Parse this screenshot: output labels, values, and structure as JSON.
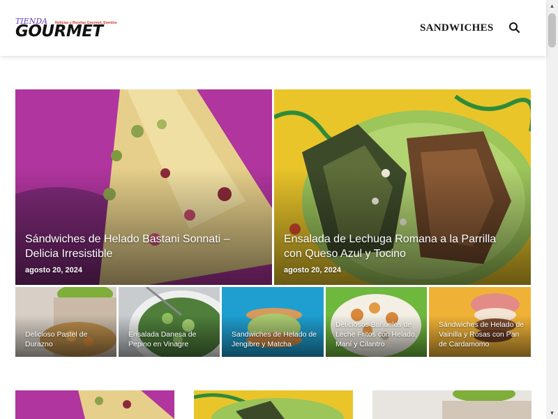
{
  "header": {
    "logo": {
      "top": "TIENDA",
      "main": "GOURMET",
      "tagline": "Noticias y Recetas Gourmet, Eventos"
    },
    "nav": {
      "sandwiches_label": "SANDWICHES"
    },
    "search_icon": "search-icon"
  },
  "featured": [
    {
      "title": "Sándwiches de Helado Bastani Sonnati – Delicia Irresistible",
      "date": "agosto 20, 2024"
    },
    {
      "title": "Ensalada de Lechuga Romana a la Parrilla con Queso Azul y Tocino",
      "date": "agosto 20, 2024"
    }
  ],
  "posts": [
    {
      "title": "Delicioso Pastel de Durazno"
    },
    {
      "title": "Ensalada Danesa de Pepino en Vinagre"
    },
    {
      "title": "Sandwiches de Helado de Jengibre y Matcha"
    },
    {
      "title": "Deliciosos Buñuelos de Leche Fritos con Helado, Maní y Cilantro"
    },
    {
      "title": "Sándwiches de Helado de Vainilla y Rosas con Pan de Cardamomo"
    }
  ],
  "colors": {
    "logo_accent": "#6a3fc2",
    "logo_tag": "#d0312d",
    "text": "#111111"
  }
}
